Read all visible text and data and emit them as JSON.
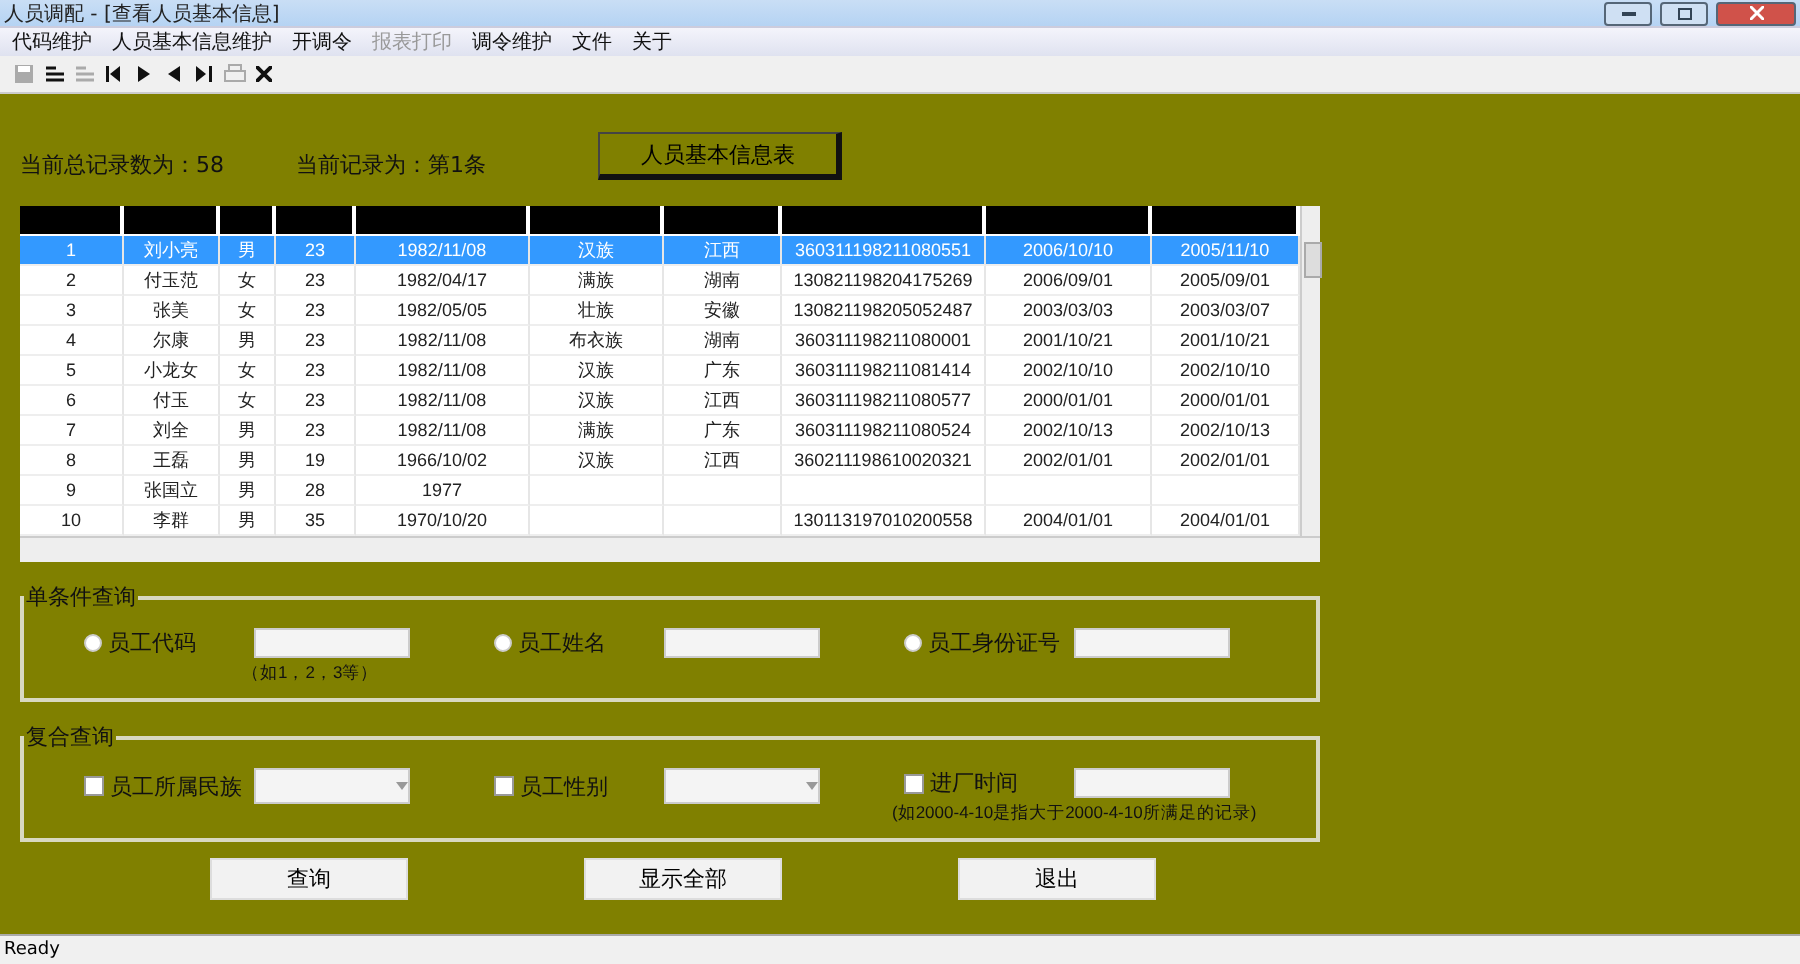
{
  "window": {
    "title": "人员调配 - [查看人员基本信息]"
  },
  "menu": [
    {
      "label": "代码维护",
      "disabled": false
    },
    {
      "label": "人员基本信息维护",
      "disabled": false
    },
    {
      "label": "开调令",
      "disabled": false
    },
    {
      "label": "报表打印",
      "disabled": true
    },
    {
      "label": "调令维护",
      "disabled": false
    },
    {
      "label": "文件",
      "disabled": false
    },
    {
      "label": "关于",
      "disabled": false
    }
  ],
  "toolbar": [
    {
      "kind": "save",
      "disabled": true
    },
    {
      "kind": "list",
      "disabled": false
    },
    {
      "kind": "list",
      "disabled": true
    },
    {
      "kind": "first",
      "disabled": false
    },
    {
      "kind": "next",
      "disabled": false
    },
    {
      "kind": "prev",
      "disabled": false
    },
    {
      "kind": "last",
      "disabled": false
    },
    {
      "kind": "print",
      "disabled": true
    },
    {
      "kind": "close",
      "disabled": false
    }
  ],
  "summary": {
    "total": "当前总记录数为：58",
    "current": "当前记录为：第1条",
    "table_button": "人员基本信息表"
  },
  "table": {
    "rows": [
      {
        "selected": true,
        "cells": [
          "1",
          "刘小亮",
          "男",
          "23",
          "1982/11/08",
          "汉族",
          "江西",
          "360311198211080551",
          "2006/10/10",
          "2005/11/10"
        ]
      },
      {
        "selected": false,
        "cells": [
          "2",
          "付玉范",
          "女",
          "23",
          "1982/04/17",
          "满族",
          "湖南",
          "130821198204175269",
          "2006/09/01",
          "2005/09/01"
        ]
      },
      {
        "selected": false,
        "cells": [
          "3",
          "张美",
          "女",
          "23",
          "1982/05/05",
          "壮族",
          "安徽",
          "130821198205052487",
          "2003/03/03",
          "2003/03/07"
        ]
      },
      {
        "selected": false,
        "cells": [
          "4",
          "尔康",
          "男",
          "23",
          "1982/11/08",
          "布衣族",
          "湖南",
          "360311198211080001",
          "2001/10/21",
          "2001/10/21"
        ]
      },
      {
        "selected": false,
        "cells": [
          "5",
          "小龙女",
          "女",
          "23",
          "1982/11/08",
          "汉族",
          "广东",
          "360311198211081414",
          "2002/10/10",
          "2002/10/10"
        ]
      },
      {
        "selected": false,
        "cells": [
          "6",
          "付玉",
          "女",
          "23",
          "1982/11/08",
          "汉族",
          "江西",
          "360311198211080577",
          "2000/01/01",
          "2000/01/01"
        ]
      },
      {
        "selected": false,
        "cells": [
          "7",
          "刘全",
          "男",
          "23",
          "1982/11/08",
          "满族",
          "广东",
          "360311198211080524",
          "2002/10/13",
          "2002/10/13"
        ]
      },
      {
        "selected": false,
        "cells": [
          "8",
          "王磊",
          "男",
          "19",
          "1966/10/02",
          "汉族",
          "江西",
          "360211198610020321",
          "2002/01/01",
          "2002/01/01"
        ]
      },
      {
        "selected": false,
        "cells": [
          "9",
          "张国立",
          "男",
          "28",
          "1977",
          null,
          null,
          null,
          null,
          null
        ]
      },
      {
        "selected": false,
        "cells": [
          "10",
          "李群",
          "男",
          "35",
          "1970/10/20",
          null,
          null,
          "130113197010200558",
          "2004/01/01",
          "2004/01/01"
        ]
      }
    ]
  },
  "single_query": {
    "legend": "单条件查询",
    "options": [
      {
        "label": "员工代码",
        "selected": false,
        "hint": "（如1，2，3等）"
      },
      {
        "label": "员工姓名",
        "selected": false
      },
      {
        "label": "员工身份证号",
        "selected": false
      }
    ]
  },
  "compound_query": {
    "legend": "复合查询",
    "options": [
      {
        "label": "员工所属民族",
        "checked": false,
        "kind": "select"
      },
      {
        "label": "员工性别",
        "checked": false,
        "kind": "select"
      },
      {
        "label": "进厂时间",
        "checked": false,
        "kind": "text",
        "hint": "(如2000-4-10是指大于2000-4-10所满足的记录)"
      }
    ]
  },
  "buttons": [
    "查询",
    "显示全部",
    "退出"
  ],
  "status_bar": "Ready"
}
